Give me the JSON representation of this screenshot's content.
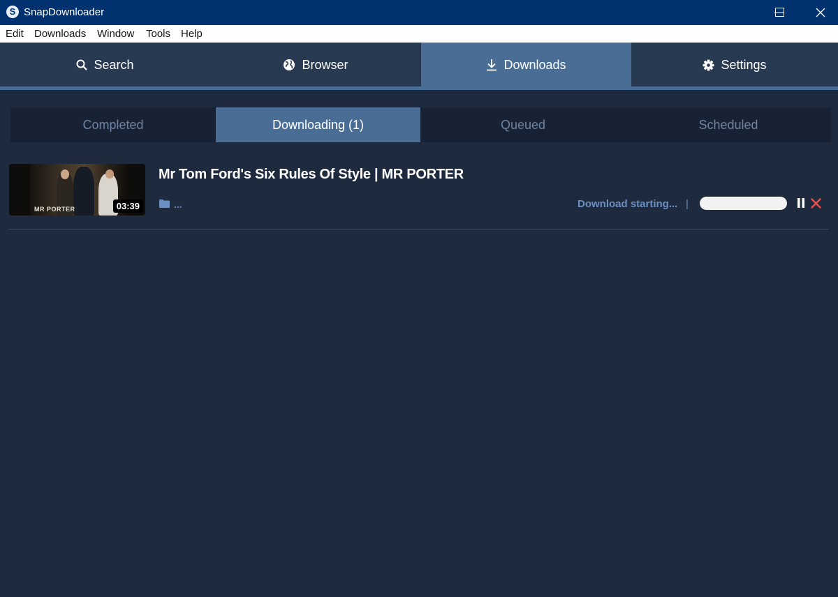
{
  "window": {
    "title": "SnapDownloader",
    "app_icon_letter": "S"
  },
  "menu": [
    "Edit",
    "Downloads",
    "Window",
    "Tools",
    "Help"
  ],
  "main_tabs": [
    {
      "label": "Search",
      "icon": "search-icon"
    },
    {
      "label": "Browser",
      "icon": "globe-icon"
    },
    {
      "label": "Downloads",
      "icon": "download-icon",
      "active": true
    },
    {
      "label": "Settings",
      "icon": "gear-icon"
    }
  ],
  "sub_tabs": [
    {
      "label": "Completed"
    },
    {
      "label": "Downloading (1)",
      "active": true
    },
    {
      "label": "Queued"
    },
    {
      "label": "Scheduled"
    }
  ],
  "downloads": [
    {
      "title": "Mr Tom Ford's Six Rules Of Style | MR PORTER",
      "duration": "03:39",
      "thumbnail_brand": "MR PORTER",
      "path": "...",
      "status": "Download starting...",
      "separator": "|",
      "progress": 0
    }
  ],
  "colors": {
    "titlebar": "#01316f",
    "accent": "#4a6d96",
    "background": "#1e2a3e",
    "status_text": "#6b8fc0",
    "cancel": "#e05252"
  }
}
